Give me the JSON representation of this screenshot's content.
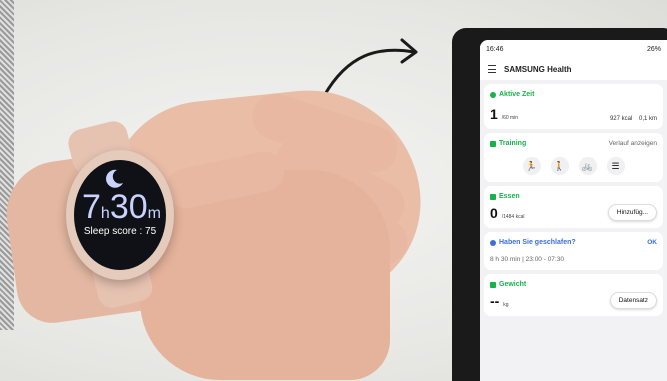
{
  "watch": {
    "hours": "7",
    "hours_unit": "h",
    "minutes": "30",
    "minutes_unit": "m",
    "sleep_score": "Sleep score : 75"
  },
  "phone": {
    "status_time": "16:46",
    "status_right": "26%",
    "app_title": "SAMSUNG Health",
    "cards": {
      "active": {
        "title": "Aktive Zeit",
        "value": "1",
        "unit": "/60 min",
        "kcal": "927 kcal",
        "km": "0,1 km"
      },
      "training": {
        "title": "Training",
        "link": "Verlauf anzeigen",
        "icons": [
          "running-icon",
          "walking-icon",
          "cycling-icon",
          "list-icon"
        ]
      },
      "food": {
        "title": "Essen",
        "value": "0",
        "unit": "/1484 kcal",
        "button": "Hinzufüg..."
      },
      "sleep": {
        "title": "Haben Sie geschlafen?",
        "ok": "OK",
        "detail": "8 h 30 min | 23:00 - 07:30"
      },
      "weight": {
        "title": "Gewicht",
        "value": "--",
        "unit": "kg",
        "button": "Datensatz"
      }
    }
  },
  "colors": {
    "accent_green": "#19b14c",
    "accent_blue": "#3a6fd8",
    "watch_face": "#0f1116"
  }
}
